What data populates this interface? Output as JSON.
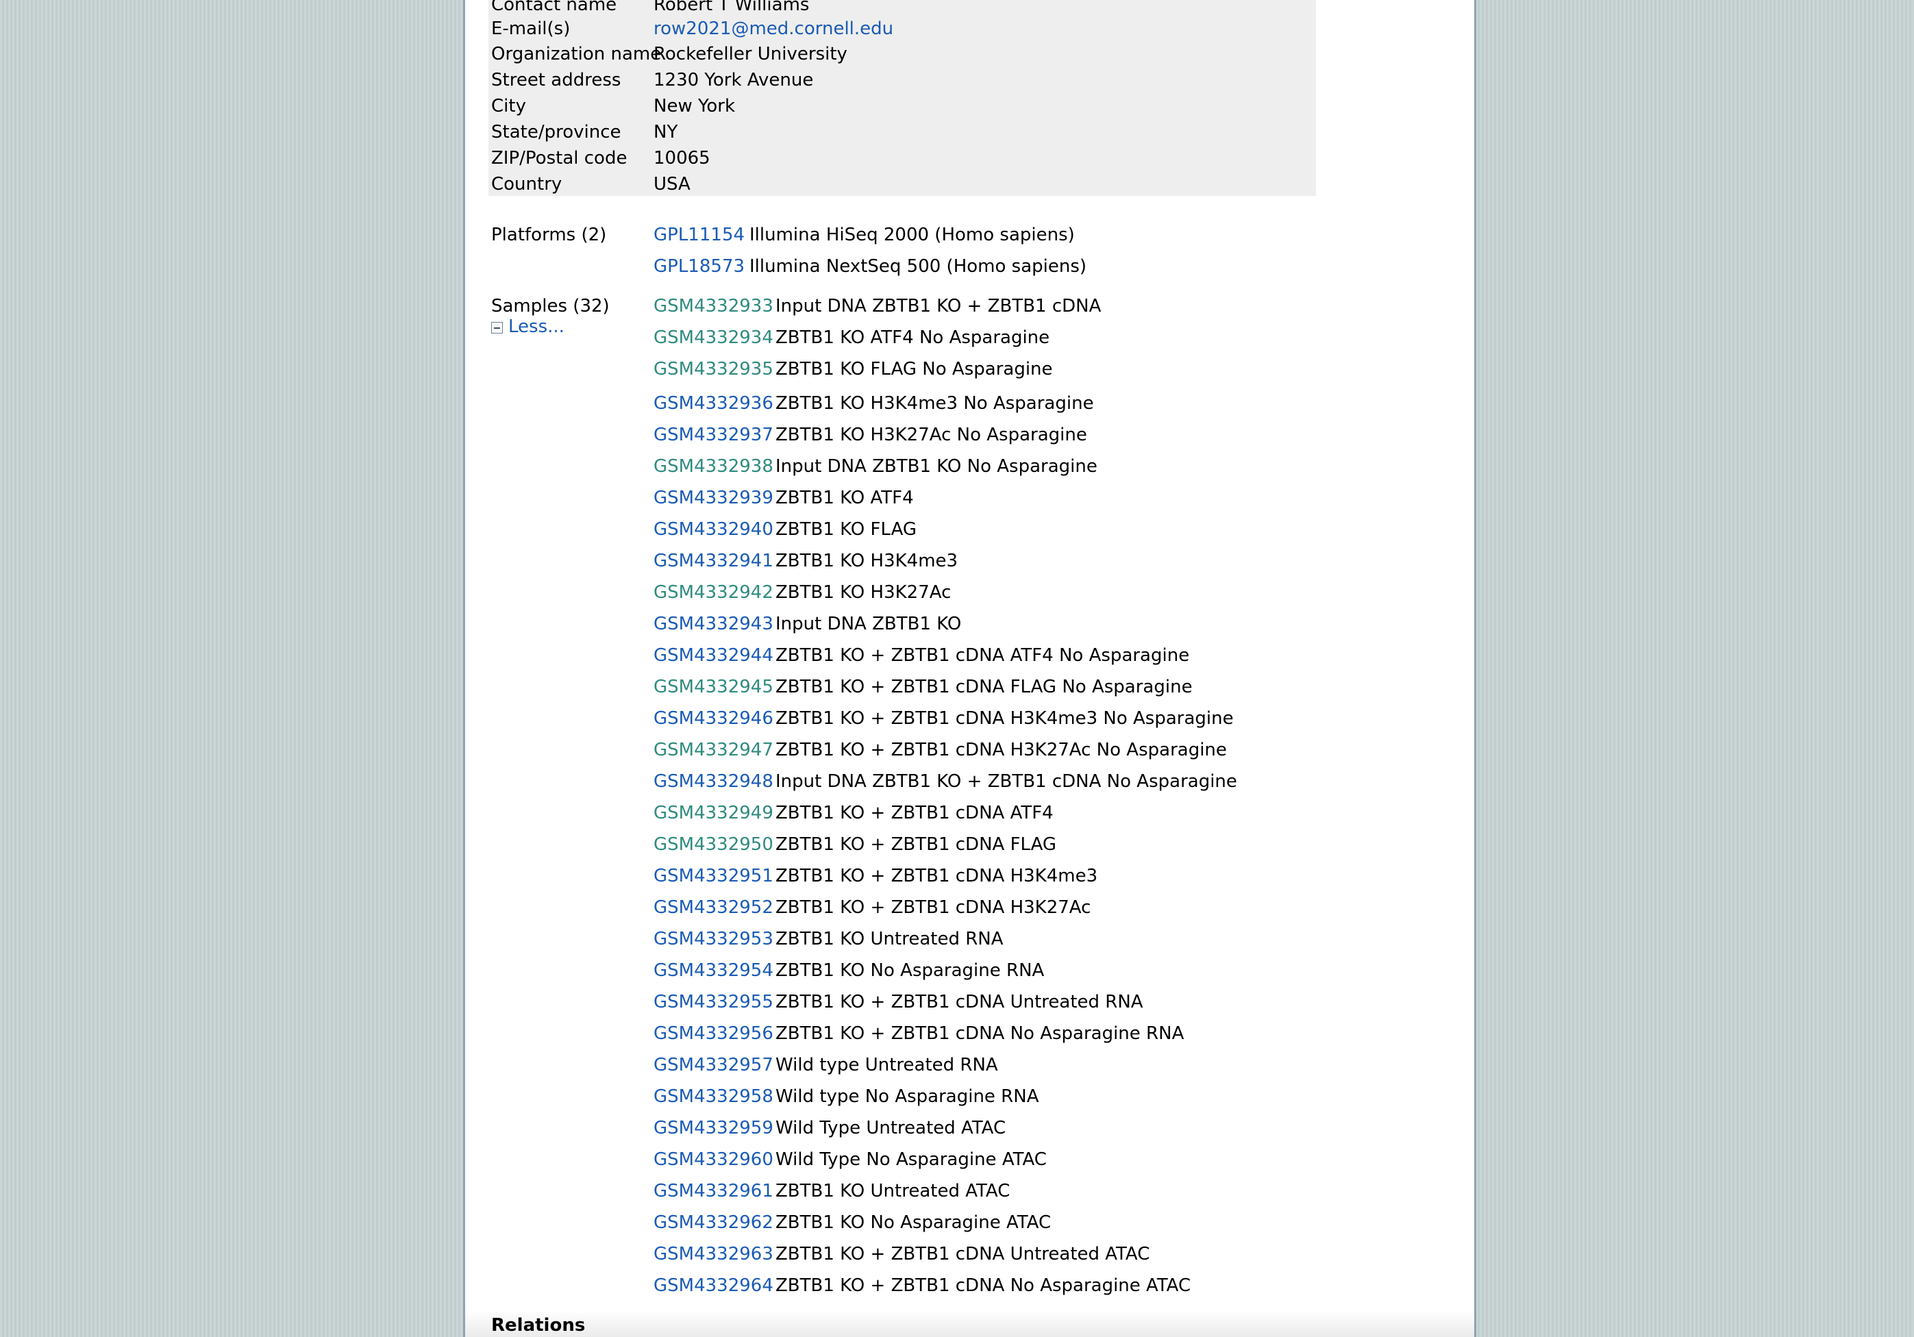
{
  "contact": {
    "rows": [
      {
        "label": "Contact name",
        "value": "Robert T Williams"
      },
      {
        "label": "E-mail(s)",
        "value": "row2021@med.cornell.edu"
      },
      {
        "label": "Organization name",
        "value": "Rockefeller University"
      },
      {
        "label": "Street address",
        "value": "1230 York Avenue"
      },
      {
        "label": "City",
        "value": "New York"
      },
      {
        "label": "State/province",
        "value": "NY"
      },
      {
        "label": "ZIP/Postal code",
        "value": "10065"
      },
      {
        "label": "Country",
        "value": "USA"
      }
    ]
  },
  "platforms": {
    "label": "Platforms (2)",
    "items": [
      {
        "id": "GPL11154",
        "title": "Illumina HiSeq 2000 (Homo sapiens)"
      },
      {
        "id": "GPL18573",
        "title": "Illumina NextSeq 500 (Homo sapiens)"
      }
    ]
  },
  "samples": {
    "label": "Samples (32)",
    "less_label": "Less...",
    "items": [
      {
        "id": "GSM4332933",
        "title": "Input DNA ZBTB1 KO + ZBTB1 cDNA",
        "visited": true
      },
      {
        "id": "GSM4332934",
        "title": "ZBTB1 KO ATF4 No Asparagine",
        "visited": true
      },
      {
        "id": "GSM4332935",
        "title": "ZBTB1 KO FLAG No Asparagine",
        "visited": true
      },
      {
        "id": "GSM4332936",
        "title": "ZBTB1 KO H3K4me3 No Asparagine",
        "visited": false
      },
      {
        "id": "GSM4332937",
        "title": "ZBTB1 KO H3K27Ac No Asparagine",
        "visited": false
      },
      {
        "id": "GSM4332938",
        "title": "Input DNA ZBTB1 KO No Asparagine",
        "visited": true
      },
      {
        "id": "GSM4332939",
        "title": "ZBTB1 KO ATF4",
        "visited": false
      },
      {
        "id": "GSM4332940",
        "title": "ZBTB1 KO FLAG",
        "visited": false
      },
      {
        "id": "GSM4332941",
        "title": "ZBTB1 KO H3K4me3",
        "visited": false
      },
      {
        "id": "GSM4332942",
        "title": "ZBTB1 KO H3K27Ac",
        "visited": true
      },
      {
        "id": "GSM4332943",
        "title": "Input DNA ZBTB1 KO",
        "visited": false
      },
      {
        "id": "GSM4332944",
        "title": "ZBTB1 KO + ZBTB1 cDNA ATF4 No Asparagine",
        "visited": false
      },
      {
        "id": "GSM4332945",
        "title": "ZBTB1 KO + ZBTB1 cDNA FLAG No Asparagine",
        "visited": true
      },
      {
        "id": "GSM4332946",
        "title": "ZBTB1 KO + ZBTB1 cDNA H3K4me3 No Asparagine",
        "visited": false
      },
      {
        "id": "GSM4332947",
        "title": "ZBTB1 KO + ZBTB1 cDNA H3K27Ac No Asparagine",
        "visited": true
      },
      {
        "id": "GSM4332948",
        "title": "Input DNA ZBTB1 KO + ZBTB1 cDNA No Asparagine",
        "visited": false
      },
      {
        "id": "GSM4332949",
        "title": "ZBTB1 KO + ZBTB1 cDNA ATF4",
        "visited": true
      },
      {
        "id": "GSM4332950",
        "title": "ZBTB1 KO + ZBTB1 cDNA FLAG",
        "visited": true
      },
      {
        "id": "GSM4332951",
        "title": "ZBTB1 KO + ZBTB1 cDNA H3K4me3",
        "visited": false
      },
      {
        "id": "GSM4332952",
        "title": "ZBTB1 KO + ZBTB1 cDNA H3K27Ac",
        "visited": false
      },
      {
        "id": "GSM4332953",
        "title": "ZBTB1 KO Untreated RNA",
        "visited": false
      },
      {
        "id": "GSM4332954",
        "title": "ZBTB1 KO No Asparagine RNA",
        "visited": false
      },
      {
        "id": "GSM4332955",
        "title": "ZBTB1 KO + ZBTB1 cDNA Untreated RNA",
        "visited": false
      },
      {
        "id": "GSM4332956",
        "title": "ZBTB1 KO + ZBTB1 cDNA No Asparagine RNA",
        "visited": false
      },
      {
        "id": "GSM4332957",
        "title": "Wild type Untreated RNA",
        "visited": false
      },
      {
        "id": "GSM4332958",
        "title": "Wild type No Asparagine RNA",
        "visited": false
      },
      {
        "id": "GSM4332959",
        "title": "Wild Type Untreated ATAC",
        "visited": false
      },
      {
        "id": "GSM4332960",
        "title": "Wild Type No Asparagine ATAC",
        "visited": false
      },
      {
        "id": "GSM4332961",
        "title": "ZBTB1 KO Untreated ATAC",
        "visited": false
      },
      {
        "id": "GSM4332962",
        "title": "ZBTB1 KO No Asparagine ATAC",
        "visited": false
      },
      {
        "id": "GSM4332963",
        "title": "ZBTB1 KO + ZBTB1 cDNA Untreated ATAC",
        "visited": false
      },
      {
        "id": "GSM4332964",
        "title": "ZBTB1 KO + ZBTB1 cDNA No Asparagine ATAC",
        "visited": false
      }
    ]
  },
  "relations": {
    "heading": "Relations"
  },
  "colors": {
    "link": "#1a5bb5",
    "visited_link": "#2e8b7f",
    "contact_background": "#eeeeee",
    "page_background": "#c7d3d3"
  }
}
